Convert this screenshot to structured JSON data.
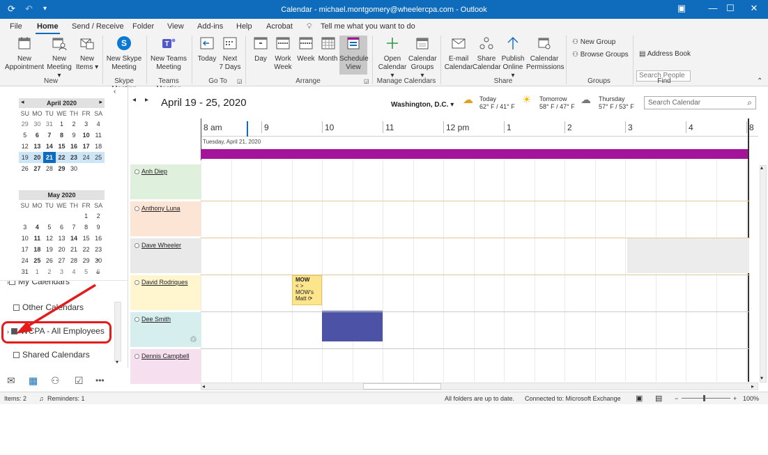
{
  "window": {
    "title": "Calendar - michael.montgomery@wheelercpa.com  -  Outlook",
    "sync_icon": "sync-icon",
    "undo_icon": "undo-icon",
    "customize_icon": "quick-access-dropdown-icon",
    "controls": [
      "ribbon-display-icon",
      "minimize-icon",
      "maximize-icon",
      "close-icon"
    ]
  },
  "tabs": [
    "File",
    "Home",
    "Send / Receive",
    "Folder",
    "View",
    "Add-ins",
    "Help",
    "Acrobat"
  ],
  "active_tab": "Home",
  "tell_me": "Tell me what you want to do",
  "ribbon": {
    "new_group": {
      "label": "New",
      "buttons": [
        {
          "line1": "New",
          "line2": "Appointment",
          "icon": "calendar-icon"
        },
        {
          "line1": "New",
          "line2": "Meeting ▾",
          "icon": "meeting-icon"
        },
        {
          "line1": "New",
          "line2": "Items ▾",
          "icon": "new-items-icon"
        }
      ]
    },
    "skype_group": {
      "label": "Skype Meeting",
      "button": {
        "line1": "New Skype",
        "line2": "Meeting",
        "icon": "skype-icon"
      }
    },
    "teams_group": {
      "label": "Teams Meeting",
      "button": {
        "line1": "New Teams",
        "line2": "Meeting",
        "icon": "teams-icon"
      }
    },
    "goto_group": {
      "label": "Go To",
      "buttons": [
        {
          "line1": "Today",
          "line2": "",
          "icon": "today-icon"
        },
        {
          "line1": "Next",
          "line2": "7 Days",
          "icon": "next-7-days-icon"
        }
      ]
    },
    "arrange_group": {
      "label": "Arrange",
      "buttons": [
        {
          "line1": "Day",
          "line2": "",
          "icon": "day-icon"
        },
        {
          "line1": "Work",
          "line2": "Week",
          "icon": "work-week-icon"
        },
        {
          "line1": "Week",
          "line2": "",
          "icon": "week-icon"
        },
        {
          "line1": "Month",
          "line2": "",
          "icon": "month-icon"
        },
        {
          "line1": "Schedule",
          "line2": "View",
          "icon": "schedule-view-icon"
        }
      ]
    },
    "manage_group": {
      "label": "Manage Calendars",
      "buttons": [
        {
          "line1": "Open",
          "line2": "Calendar ▾",
          "icon": "open-calendar-icon"
        },
        {
          "line1": "Calendar",
          "line2": "Groups ▾",
          "icon": "calendar-groups-icon"
        }
      ]
    },
    "share_group": {
      "label": "Share",
      "buttons": [
        {
          "line1": "E-mail",
          "line2": "Calendar",
          "icon": "email-calendar-icon"
        },
        {
          "line1": "Share",
          "line2": "Calendar",
          "icon": "share-calendar-icon"
        },
        {
          "line1": "Publish",
          "line2": "Online ▾",
          "icon": "publish-online-icon"
        },
        {
          "line1": "Calendar",
          "line2": "Permissions",
          "icon": "calendar-permissions-icon"
        }
      ]
    },
    "groups_group": {
      "label": "Groups",
      "new_group": "New Group",
      "browse_groups": "Browse Groups"
    },
    "find_group": {
      "label": "Find",
      "search_people": "Search People",
      "address_book": "Address Book"
    }
  },
  "mini_cal": {
    "april": {
      "title": "April 2020",
      "dow": [
        "SU",
        "MO",
        "TU",
        "WE",
        "TH",
        "FR",
        "SA"
      ],
      "weeks": [
        [
          "29",
          "30",
          "31",
          "1",
          "2",
          "3",
          "4"
        ],
        [
          "5",
          "6",
          "7",
          "8",
          "9",
          "10",
          "11"
        ],
        [
          "12",
          "13",
          "14",
          "15",
          "16",
          "17",
          "18"
        ],
        [
          "19",
          "20",
          "21",
          "22",
          "23",
          "24",
          "25"
        ],
        [
          "26",
          "27",
          "28",
          "29",
          "30",
          "",
          ""
        ]
      ]
    },
    "may": {
      "title": "May 2020",
      "dow": [
        "SU",
        "MO",
        "TU",
        "WE",
        "TH",
        "FR",
        "SA"
      ],
      "weeks": [
        [
          "",
          "",
          "",
          "",
          "",
          "1",
          "2"
        ],
        [
          "3",
          "4",
          "5",
          "6",
          "7",
          "8",
          "9"
        ],
        [
          "10",
          "11",
          "12",
          "13",
          "14",
          "15",
          "16"
        ],
        [
          "17",
          "18",
          "19",
          "20",
          "21",
          "22",
          "23"
        ],
        [
          "24",
          "25",
          "26",
          "27",
          "28",
          "29",
          "30"
        ],
        [
          "31",
          "1",
          "2",
          "3",
          "4",
          "5",
          "6"
        ]
      ]
    }
  },
  "folders": {
    "my_calendars": "My Calendars",
    "other": "Other Calendars",
    "wcpa": "WCPA - All Employees",
    "shared": "Shared Calendars"
  },
  "nav_icons": [
    "mail-icon",
    "calendar-icon",
    "people-icon",
    "tasks-icon",
    "more-icon"
  ],
  "calendar": {
    "date_range": "April 19 - 25, 2020",
    "location": "Washington, D.C.",
    "weather": [
      {
        "day": "Today",
        "temp": "62° F / 41° F",
        "icon": "partly-cloudy-icon"
      },
      {
        "day": "Tomorrow",
        "temp": "58° F / 47° F",
        "icon": "sun-icon"
      },
      {
        "day": "Thursday",
        "temp": "57° F / 53° F",
        "icon": "cloud-icon"
      }
    ],
    "search_placeholder": "Search Calendar",
    "hours": [
      "8 am",
      "9",
      "10",
      "11",
      "12 pm",
      "1",
      "2",
      "3",
      "4",
      "8"
    ],
    "date_header": "Tuesday, April 21, 2020",
    "people": [
      "Anh Diep",
      "Anthony Luna",
      "Dave Wheeler",
      "David Rodriques",
      "Dee Smith",
      "Dennis Campbell"
    ],
    "person_colors": [
      "#dff0dc",
      "#fde5d6",
      "#e9e9e9",
      "#fff5cf",
      "#d6efee",
      "#f6e0f0"
    ],
    "event": {
      "title": "MOW",
      "line2": "< >",
      "line3": "MOW's",
      "line4": "Matt"
    },
    "allday_color": "#a4149a"
  },
  "status": {
    "items": "Items: 2",
    "reminders": "Reminders: 1",
    "sync": "All folders are up to date.",
    "connection": "Connected to: Microsoft Exchange",
    "zoom": "100%"
  }
}
